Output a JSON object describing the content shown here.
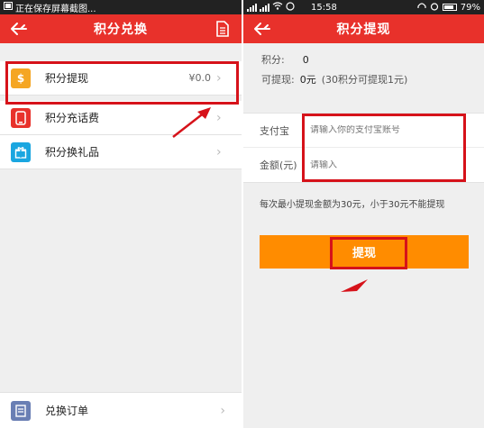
{
  "left_screen": {
    "statusbar": {
      "text": "正在保存屏幕截图..."
    },
    "title": "积分兑换",
    "menu": [
      {
        "label": "积分提现",
        "value": "¥0.0",
        "icon": "dollar-coin-icon",
        "icon_color": "#f5a623"
      },
      {
        "label": "积分充话费",
        "value": "",
        "icon": "phone-icon",
        "icon_color": "#e8312b"
      },
      {
        "label": "积分换礼品",
        "value": "",
        "icon": "gift-icon",
        "icon_color": "#1aa6e0"
      }
    ],
    "bottom_item": {
      "label": "兑换订单",
      "icon": "order-list-icon",
      "icon_color": "#6a7fb4"
    }
  },
  "right_screen": {
    "statusbar": {
      "time": "15:58",
      "battery": "79%"
    },
    "title": "积分提现",
    "points_label": "积分:",
    "points_value": "0",
    "withdraw_label": "可提现:",
    "withdraw_value": "0元",
    "withdraw_note": "(30积分可提现1元)",
    "alipay_label": "支付宝",
    "alipay_placeholder": "请输入你的支付宝账号",
    "amount_label": "金额(元)",
    "amount_placeholder": "请输入",
    "tip": "每次最小提现金额为30元，小于30元不能提现",
    "submit_label": "提现"
  },
  "colors": {
    "brand_red": "#e8312b",
    "submit_orange": "#ff8c00",
    "highlight": "#d6121a"
  }
}
